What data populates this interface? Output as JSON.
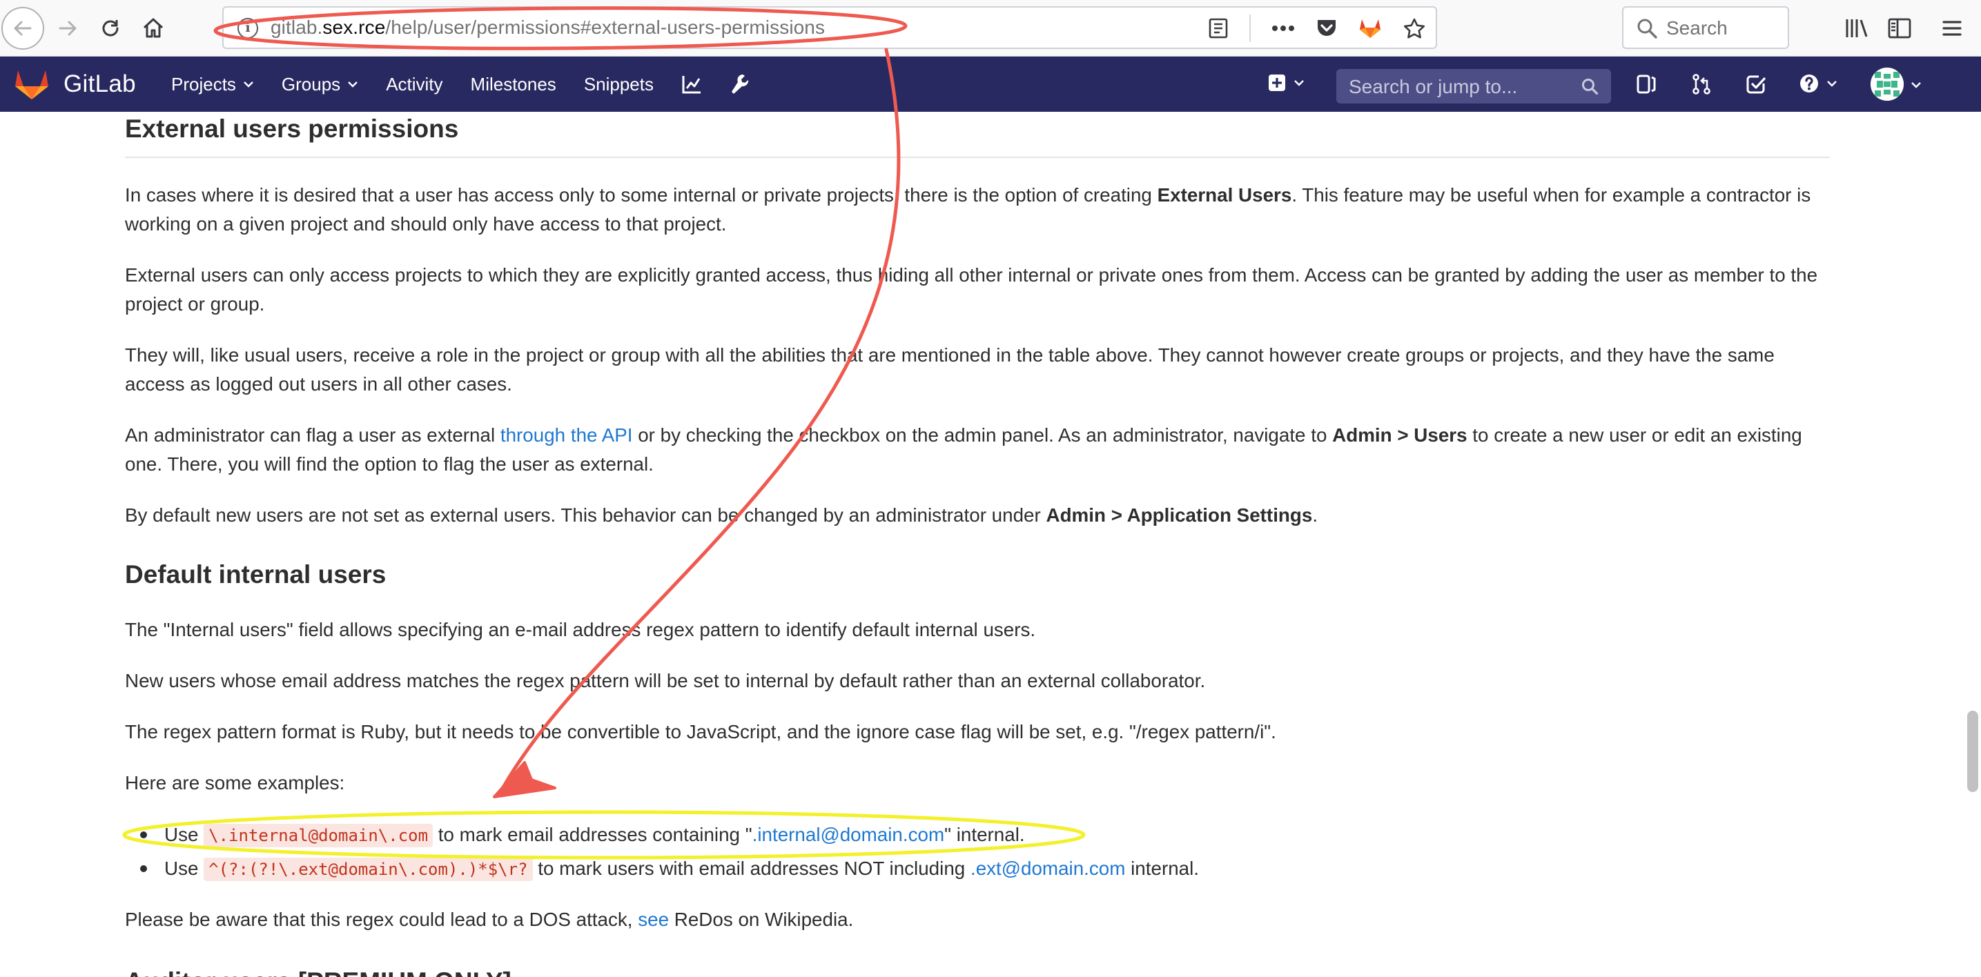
{
  "browser": {
    "url_prefix": "gitlab.",
    "url_domain": "sex.rce",
    "url_path": "/help/user/permissions#external-users-permissions",
    "search_placeholder": "Search",
    "info_glyph": "i"
  },
  "gitlab": {
    "brand": "GitLab",
    "nav": [
      {
        "label": "Projects",
        "dropdown": true
      },
      {
        "label": "Groups",
        "dropdown": true
      },
      {
        "label": "Activity",
        "dropdown": false
      },
      {
        "label": "Milestones",
        "dropdown": false
      },
      {
        "label": "Snippets",
        "dropdown": false
      }
    ],
    "search_placeholder": "Search or jump to..."
  },
  "doc": {
    "section1": {
      "heading": "External users permissions",
      "p1": {
        "before": "In cases where it is desired that a user has access only to some internal or private projects, there is the option of creating ",
        "bold": "External Users",
        "after": ". This feature may be useful when for example a contractor is working on a given project and should only have access to that project."
      },
      "p2": "External users can only access projects to which they are explicitly granted access, thus hiding all other internal or private ones from them. Access can be granted by adding the user as member to the project or group.",
      "p3": "They will, like usual users, receive a role in the project or group with all the abilities that are mentioned in the table above. They cannot however create groups or projects, and they have the same access as logged out users in all other cases.",
      "p4": {
        "before": "An administrator can flag a user as external ",
        "link": "through the API",
        "middle": " or by checking the checkbox on the admin panel. As an administrator, navigate to ",
        "bold": "Admin > Users",
        "after": " to create a new user or edit an existing one. There, you will find the option to flag the user as external."
      },
      "p5": {
        "before": "By default new users are not set as external users. This behavior can be changed by an administrator under ",
        "bold": "Admin > Application Settings",
        "after": "."
      }
    },
    "section2": {
      "heading": "Default internal users",
      "p1": "The \"Internal users\" field allows specifying an e-mail address regex pattern to identify default internal users.",
      "p2": "New users whose email address matches the regex pattern will be set to internal by default rather than an external collaborator.",
      "p3": "The regex pattern format is Ruby, but it needs to be convertible to JavaScript, and the ignore case flag will be set, e.g. \"/regex pattern/i\".",
      "p4": "Here are some examples:",
      "examples": [
        {
          "use": "Use ",
          "code": "\\.internal@domain\\.com",
          "mid": " to mark email addresses containing \"",
          "link": ".internal@domain.com",
          "end": "\" internal."
        },
        {
          "use": "Use ",
          "code": "^(?:(?!\\.ext@domain\\.com).)*$\\r?",
          "mid": " to mark users with email addresses NOT including ",
          "link": ".ext@domain.com",
          "end": " internal."
        }
      ],
      "p5": {
        "before": "Please be aware that this regex could lead to a DOS attack, ",
        "link": "see",
        "after": " ReDos on Wikipedia."
      }
    },
    "next_heading": "Auditor users [PREMIUM ONLY]"
  },
  "colors": {
    "header_bg": "#292961",
    "link": "#1f78d1",
    "code_fg": "#c0341d",
    "code_bg": "#fbe5e1",
    "annotation_red": "#ee5a4f",
    "annotation_yellow": "#f3f02c"
  }
}
